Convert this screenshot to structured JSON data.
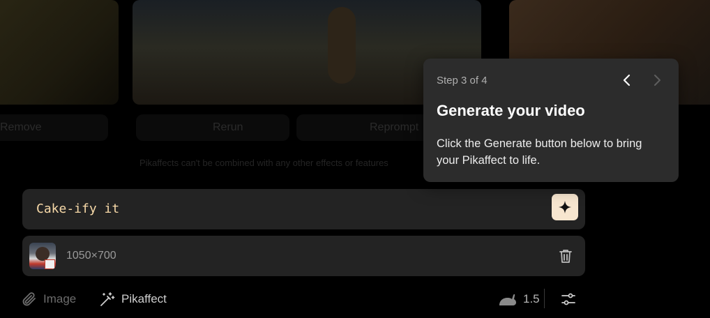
{
  "background": {
    "chips": [
      "Remove",
      "Rerun",
      "Reprompt"
    ],
    "caption": "Pikaffects can't be combined with any other effects or features"
  },
  "prompt": {
    "text": "Cake-ify it",
    "generate_icon": "sparkle-icon"
  },
  "attachment": {
    "size": "1050×700",
    "delete_icon": "trash-icon"
  },
  "toolbar": {
    "image_label": "Image",
    "image_icon": "paperclip-icon",
    "pikaffect_label": "Pikaffect",
    "pikaffect_icon": "magic-wand-icon",
    "speed_value": "1.5",
    "speed_icon": "rabbit-icon",
    "settings_icon": "sliders-icon"
  },
  "tour": {
    "step": "Step 3 of 4",
    "title": "Generate your video",
    "body": "Click the Generate button below to bring your Pikaffect to life.",
    "prev_icon": "chevron-left-icon",
    "next_icon": "chevron-right-icon"
  },
  "colors": {
    "accent": "#f7e6cf",
    "prompt_text": "#f7d9a8",
    "panel": "#232323",
    "popover": "#2c2c2c"
  }
}
